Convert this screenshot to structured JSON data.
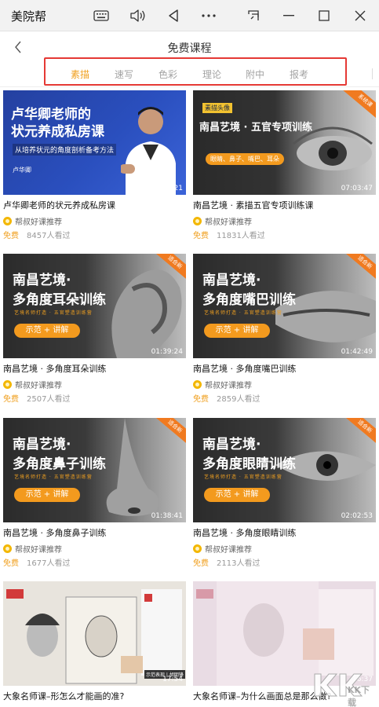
{
  "window": {
    "app_title": "美院帮"
  },
  "header": {
    "title": "免费课程"
  },
  "tabs": [
    {
      "label": "素描",
      "active": true
    },
    {
      "label": "速写",
      "active": false
    },
    {
      "label": "色彩",
      "active": false
    },
    {
      "label": "理论",
      "active": false
    },
    {
      "label": "附中",
      "active": false
    },
    {
      "label": "报考",
      "active": false
    }
  ],
  "colors": {
    "accent": "#f0a020",
    "highlight_box": "#e53935"
  },
  "courses": [
    {
      "title": "卢华卿老师的状元养成私房课",
      "recommender": "帮叔好课推荐",
      "price": "免费",
      "views": "8457人看过",
      "duration": "10:56:21",
      "thumb": {
        "headline": "卢华卿老师的\n状元养成私房课",
        "subline": "从培养状元的角度剖析备考方法",
        "teacher": "卢华卿"
      }
    },
    {
      "title": "南昌艺境 · 素描五官专项训练课",
      "recommender": "帮叔好课推荐",
      "price": "免费",
      "views": "11831人看过",
      "duration": "07:03:47",
      "thumb": {
        "tag": "素描头像",
        "headline": "南昌艺境 · 五官专项训练",
        "subtags": "眼睛、鼻子、嘴巴、耳朵",
        "corner": "系统课"
      }
    },
    {
      "title": "南昌艺境 · 多角度耳朵训练",
      "recommender": "帮叔好课推荐",
      "price": "免费",
      "views": "2507人看过",
      "duration": "01:39:24",
      "thumb": {
        "headline1": "南昌艺境·",
        "headline2": "多角度耳朵训练",
        "tagline": "艺境名师打造 · 五官塑造训练营",
        "pill": "示范 + 讲解",
        "corner": "适合新"
      }
    },
    {
      "title": "南昌艺境 · 多角度嘴巴训练",
      "recommender": "帮叔好课推荐",
      "price": "免费",
      "views": "2859人看过",
      "duration": "01:42:49",
      "thumb": {
        "headline1": "南昌艺境·",
        "headline2": "多角度嘴巴训练",
        "tagline": "艺境名师打造 · 五官塑造训练营",
        "pill": "示范 + 讲解",
        "corner": "适合新"
      }
    },
    {
      "title": "南昌艺境 · 多角度鼻子训练",
      "recommender": "帮叔好课推荐",
      "price": "免费",
      "views": "1677人看过",
      "duration": "01:38:41",
      "thumb": {
        "headline1": "南昌艺境·",
        "headline2": "多角度鼻子训练",
        "tagline": "艺境名师打造 · 五官塑造训练营",
        "pill": "示范 + 讲解",
        "corner": "适合新"
      }
    },
    {
      "title": "南昌艺境 · 多角度眼睛训练",
      "recommender": "帮叔好课推荐",
      "price": "免费",
      "views": "2113人看过",
      "duration": "02:02:53",
      "thumb": {
        "headline1": "南昌艺境·",
        "headline2": "多角度眼睛训练",
        "tagline": "艺境名师打造 · 五官塑造训练营",
        "pill": "示范 + 讲解",
        "corner": "适合新"
      }
    },
    {
      "title": "大象名师课–形怎么才能画的准?",
      "recommender": "",
      "price": "",
      "views": "",
      "duration": "17:54",
      "thumb": {
        "label": "示范表现 | 胡明锋"
      }
    },
    {
      "title": "大象名师课–为什么画面总是那么做?",
      "recommender": "",
      "price": "",
      "views": "",
      "duration": "16:37",
      "thumb": {}
    }
  ],
  "watermark": "KK下载"
}
